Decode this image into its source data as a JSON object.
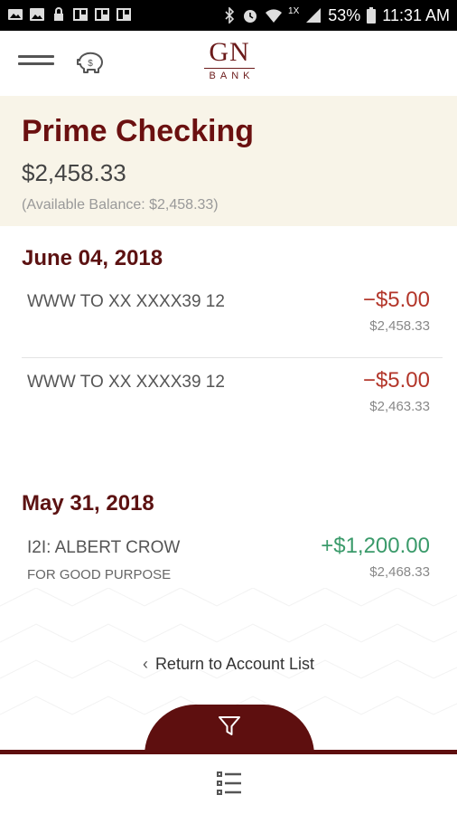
{
  "status_bar": {
    "battery": "53%",
    "time": "11:31 AM",
    "network_label": "1X"
  },
  "header": {
    "logo_main": "GN",
    "logo_sub": "BANK"
  },
  "account": {
    "name": "Prime Checking",
    "balance": "$2,458.33",
    "available": "(Available Balance: $2,458.33)"
  },
  "groups": [
    {
      "date": "June 04, 2018",
      "transactions": [
        {
          "description": "WWW TO XX XXXX39 12",
          "amount": "−$5.00",
          "running": "$2,458.33"
        },
        {
          "description": "WWW TO XX XXXX39 12",
          "amount": "−$5.00",
          "running": "$2,463.33"
        }
      ]
    },
    {
      "date": "May 31, 2018",
      "transactions": [
        {
          "description": "I2I: ALBERT CROW",
          "memo": "FOR GOOD PURPOSE",
          "amount": "+$1,200.00",
          "running": "$2,468.33"
        }
      ]
    }
  ],
  "return_link": "Return to Account List",
  "colors": {
    "brand": "#5e0f0f",
    "debit": "#b3362a",
    "credit": "#3a9a6a",
    "account_bg": "#f8f4e8"
  },
  "icons": {
    "menu": "hamburger-icon",
    "piggy": "piggy-bank-icon",
    "filter": "filter-icon",
    "list": "list-icon",
    "back": "chevron-left-icon"
  }
}
